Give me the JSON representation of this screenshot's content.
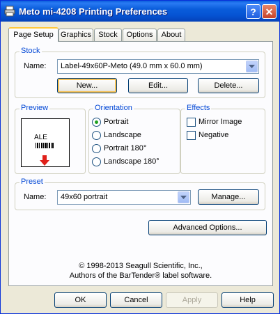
{
  "window": {
    "title": "Meto mi-4208 Printing Preferences",
    "help_label": "?",
    "close_label": "✕"
  },
  "tabs": [
    {
      "label": "Page Setup",
      "active": true
    },
    {
      "label": "Graphics"
    },
    {
      "label": "Stock"
    },
    {
      "label": "Options"
    },
    {
      "label": "About"
    }
  ],
  "stock": {
    "legend": "Stock",
    "name_label": "Name:",
    "name_value": "Label-49x60P-Meto (49.0 mm x 60.0 mm)",
    "new_label": "New...",
    "edit_label": "Edit...",
    "delete_label": "Delete..."
  },
  "preview": {
    "legend": "Preview",
    "sample_text": "ALE"
  },
  "orientation": {
    "legend": "Orientation",
    "options": [
      "Portrait",
      "Landscape",
      "Portrait 180°",
      "Landscape 180°"
    ],
    "selected": "Portrait"
  },
  "effects": {
    "legend": "Effects",
    "mirror_label": "Mirror Image",
    "negative_label": "Negative",
    "mirror_checked": false,
    "negative_checked": false
  },
  "preset": {
    "legend": "Preset",
    "name_label": "Name:",
    "name_value": "49x60 portrait",
    "manage_label": "Manage..."
  },
  "advanced_label": "Advanced Options...",
  "copyright": {
    "line1": "© 1998-2013 Seagull Scientific, Inc.,",
    "line2": "Authors of the BarTender® label software."
  },
  "footer": {
    "ok_label": "OK",
    "cancel_label": "Cancel",
    "apply_label": "Apply",
    "help_label": "Help"
  },
  "colors": {
    "titlebar": "#0a5ddb",
    "group_legend": "#0046d5",
    "tab_highlight": "#ffc83c",
    "arrow_red": "#e0201a"
  }
}
